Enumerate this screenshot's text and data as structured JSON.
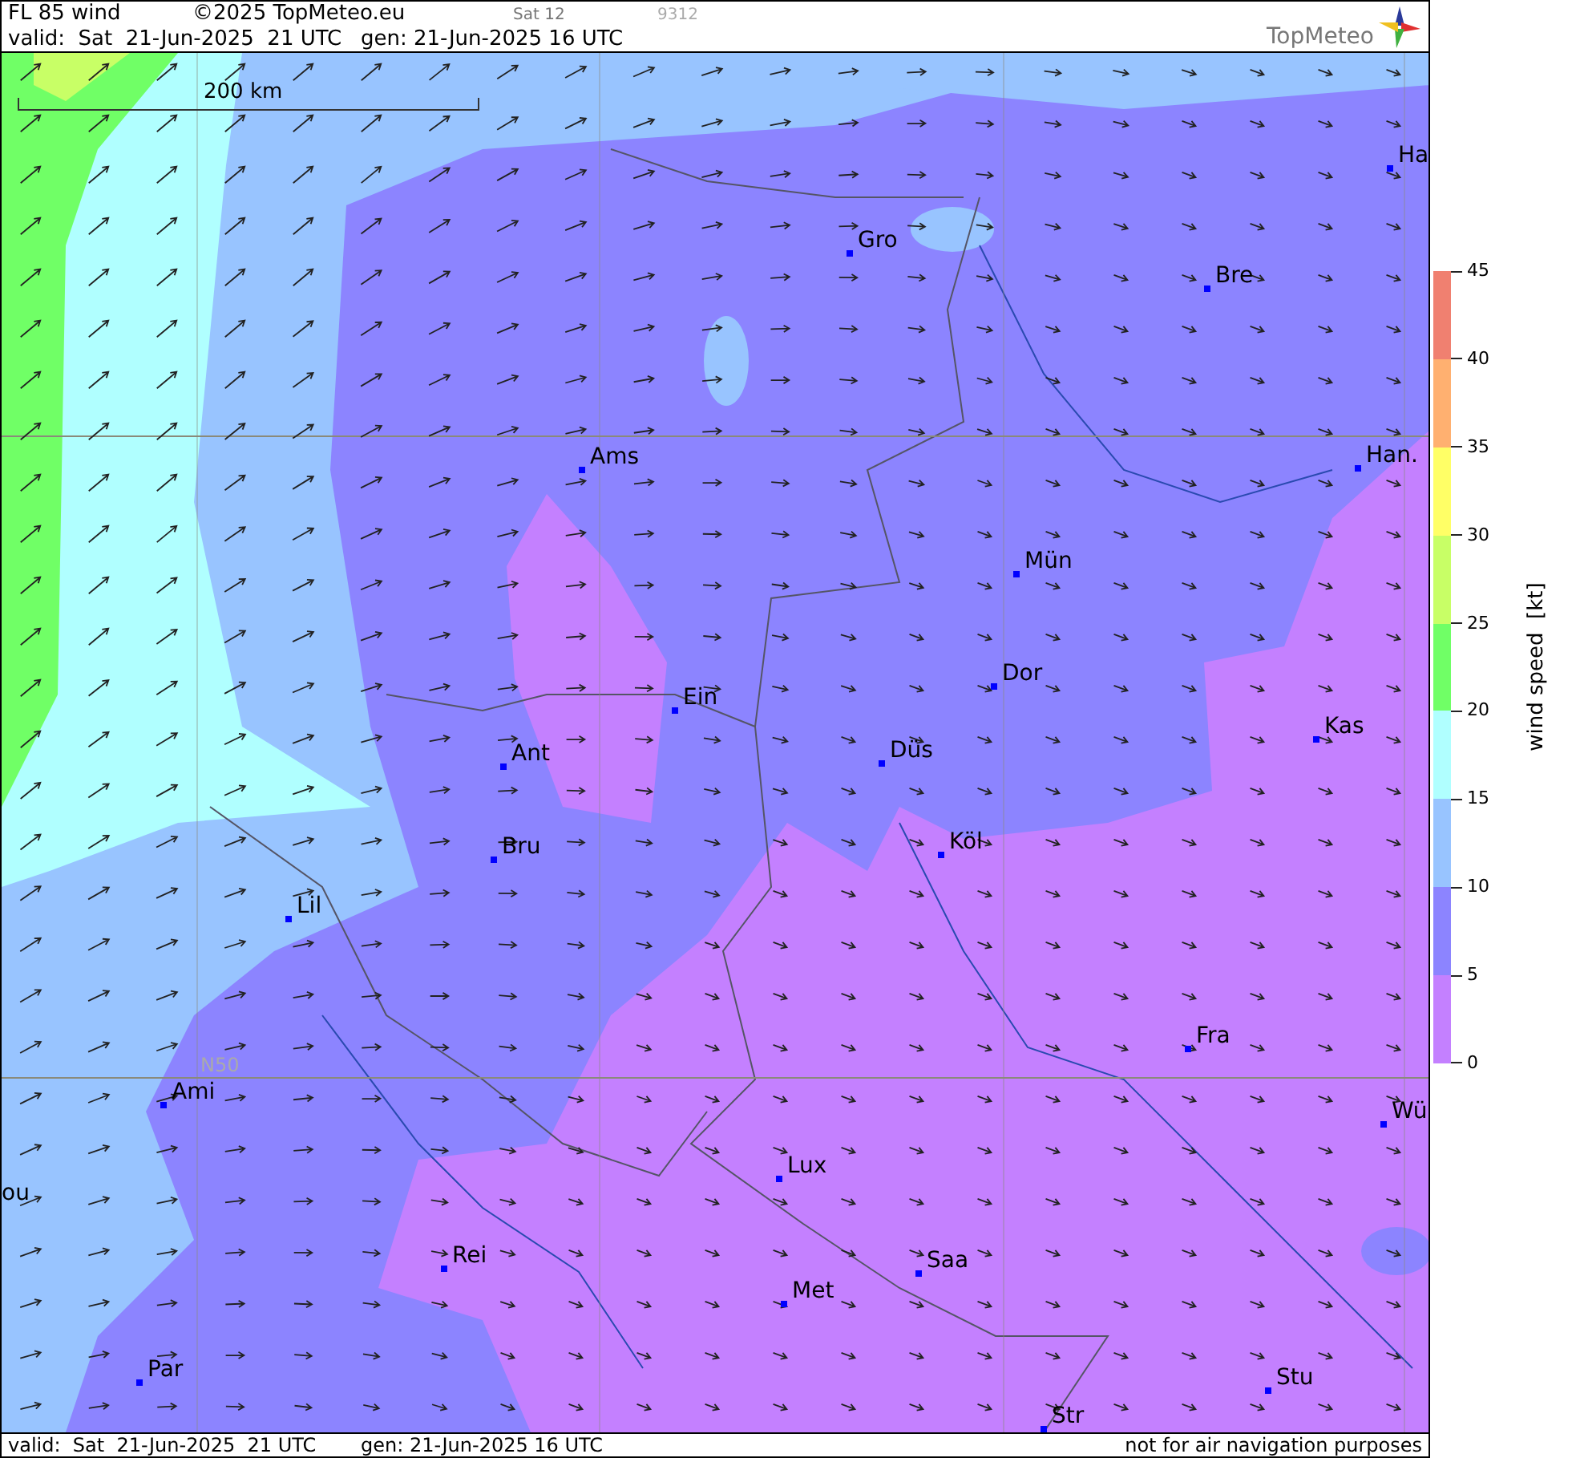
{
  "header": {
    "title": "FL 85 wind",
    "copyright": "©2025 TopMeteo.eu",
    "run": "Sat 12",
    "code": "9312",
    "valid": "valid:  Sat  21-Jun-2025  21 UTC",
    "gen": "gen: 21-Jun-2025 16 UTC",
    "logo": "TopMeteo"
  },
  "map": {
    "scale_label": "200 km",
    "lat_label": "N50",
    "cities": [
      {
        "name": "Ha"
      },
      {
        "name": "Gro"
      },
      {
        "name": "Bre"
      },
      {
        "name": "Ams"
      },
      {
        "name": "Han."
      },
      {
        "name": "Mün"
      },
      {
        "name": "Dor"
      },
      {
        "name": "Ein"
      },
      {
        "name": "Kas"
      },
      {
        "name": "Düs"
      },
      {
        "name": "Ant"
      },
      {
        "name": "Köl"
      },
      {
        "name": "Bru"
      },
      {
        "name": "Lil"
      },
      {
        "name": "Fra"
      },
      {
        "name": "Ami"
      },
      {
        "name": "Wü"
      },
      {
        "name": "Lux"
      },
      {
        "name": "ou"
      },
      {
        "name": "Rei"
      },
      {
        "name": "Saa"
      },
      {
        "name": "Met"
      },
      {
        "name": "Par"
      },
      {
        "name": "Stu"
      },
      {
        "name": "Str"
      }
    ]
  },
  "legend": {
    "title": "wind speed  [kt]",
    "ticks": [
      "45",
      "40",
      "35",
      "30",
      "25",
      "20",
      "15",
      "10",
      "5",
      "0"
    ],
    "bands": [
      {
        "color": "#f08070"
      },
      {
        "color": "#ffb070"
      },
      {
        "color": "#ffff66"
      },
      {
        "color": "#c8ff66"
      },
      {
        "color": "#70ff66"
      },
      {
        "color": "#b0ffff"
      },
      {
        "color": "#98c4ff"
      },
      {
        "color": "#8c84ff"
      },
      {
        "color": "#c480ff"
      }
    ]
  },
  "footer": {
    "valid": "valid:  Sat  21-Jun-2025  21 UTC",
    "gen": "gen: 21-Jun-2025 16 UTC",
    "disclaimer": "not for air navigation purposes"
  }
}
